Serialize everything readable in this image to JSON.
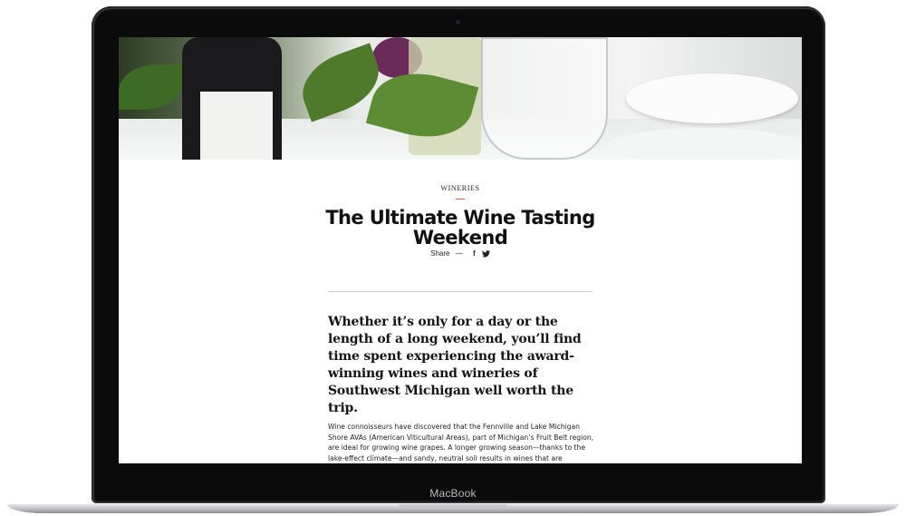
{
  "device": {
    "brand_label": "MacBook"
  },
  "article": {
    "category": "WINERIES",
    "title": "The Ultimate Wine Tasting Weekend",
    "share_label": "Share",
    "share_dash": "—",
    "facebook_glyph": "f",
    "lead": "Whether it’s only for a day or the length of a long weekend, you’ll find time spent experiencing the award-winning wines and wineries of Southwest Michigan well worth the trip.",
    "body": "Wine connoisseurs have discovered that the Fennville and Lake Michigan Shore AVAs (American Viticultural Areas), part of Michigan’s Fruit Belt region, are ideal for growing wine grapes. A longer growing season—thanks to the lake-effect climate—and sandy, neutral soil results in wines that are"
  },
  "icons": {
    "facebook": "facebook-icon",
    "twitter": "twitter-icon"
  },
  "colors": {
    "accent": "#d85b3a",
    "bezel": "#0b0b0c"
  }
}
